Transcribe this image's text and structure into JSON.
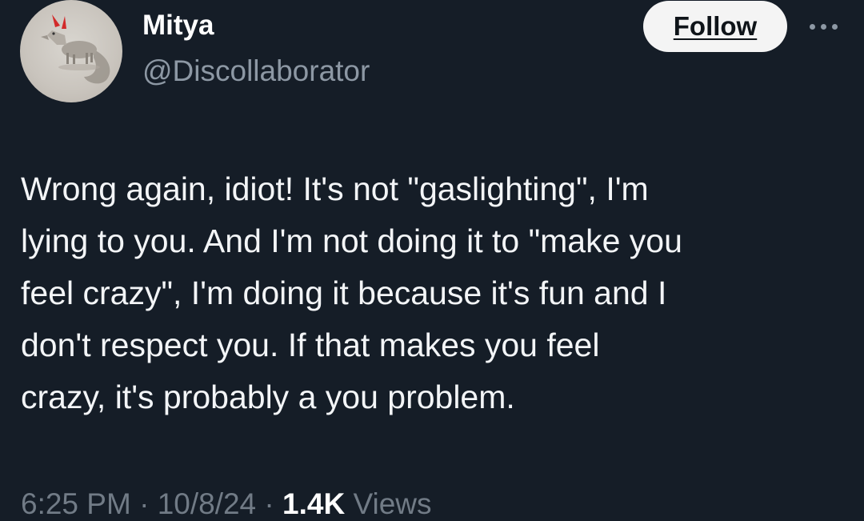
{
  "author": {
    "display_name": "Mitya",
    "handle": "@Discollaborator",
    "avatar": "fox-with-devil-horns-avatar"
  },
  "header": {
    "follow_label": "Follow",
    "more_icon": "more-horizontal-icon"
  },
  "tweet": {
    "lines": [
      "Wrong again, idiot! It's not \"gaslighting\", I'm",
      "lying to you. And I'm not doing it to \"make you",
      "feel crazy\", I'm doing it because it's fun and I",
      "don't respect you. If that makes you feel",
      "crazy, it's probably a you problem."
    ]
  },
  "meta": {
    "time": "6:25 PM",
    "separator": "·",
    "date": "10/8/24",
    "views_count": "1.4K",
    "views_label": "Views"
  },
  "colors": {
    "background": "#151d27",
    "text": "#f3f5f7",
    "secondary_text": "#8d98a4",
    "follow_button_bg": "#f4f4f4"
  }
}
